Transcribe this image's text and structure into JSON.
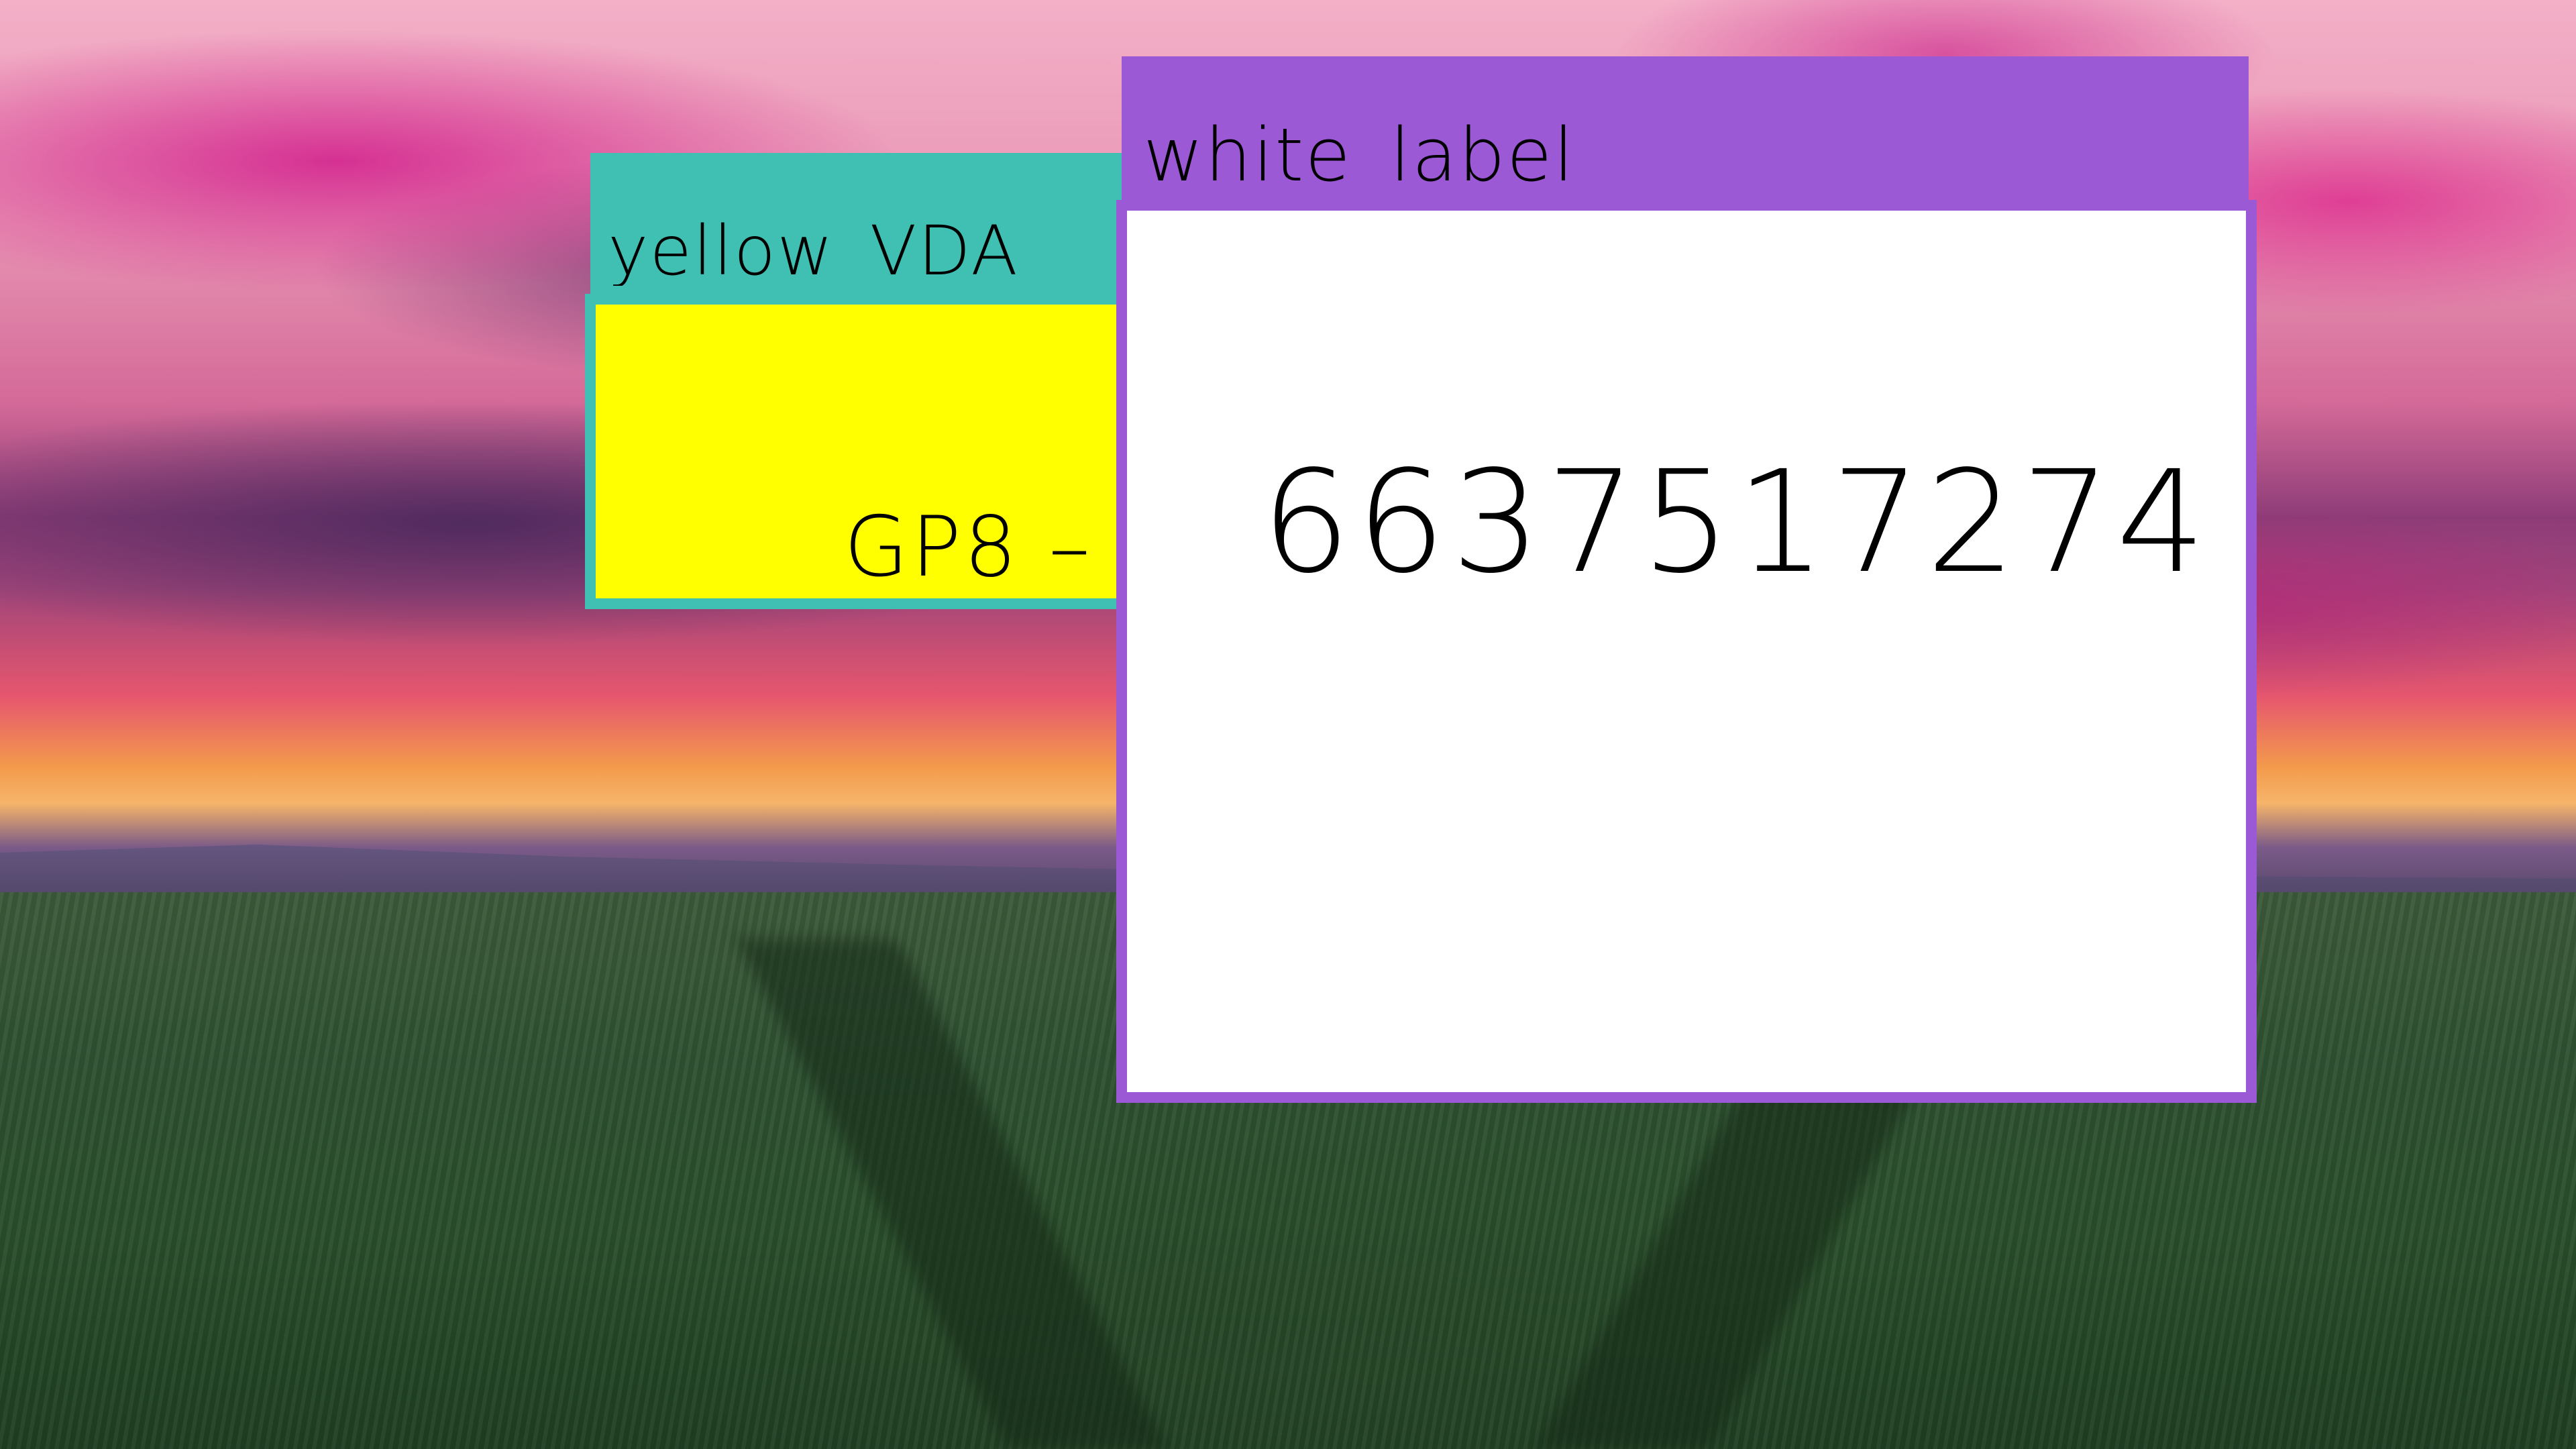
{
  "annotations": {
    "yellow": {
      "label": "yellow_VDA_",
      "value": "GP8 –",
      "color": "#3fc0b3",
      "fill": "#ffff00"
    },
    "white": {
      "label": "white_label",
      "value": "6637517274",
      "color": "#9b59d6",
      "fill": "#ffffff"
    }
  }
}
